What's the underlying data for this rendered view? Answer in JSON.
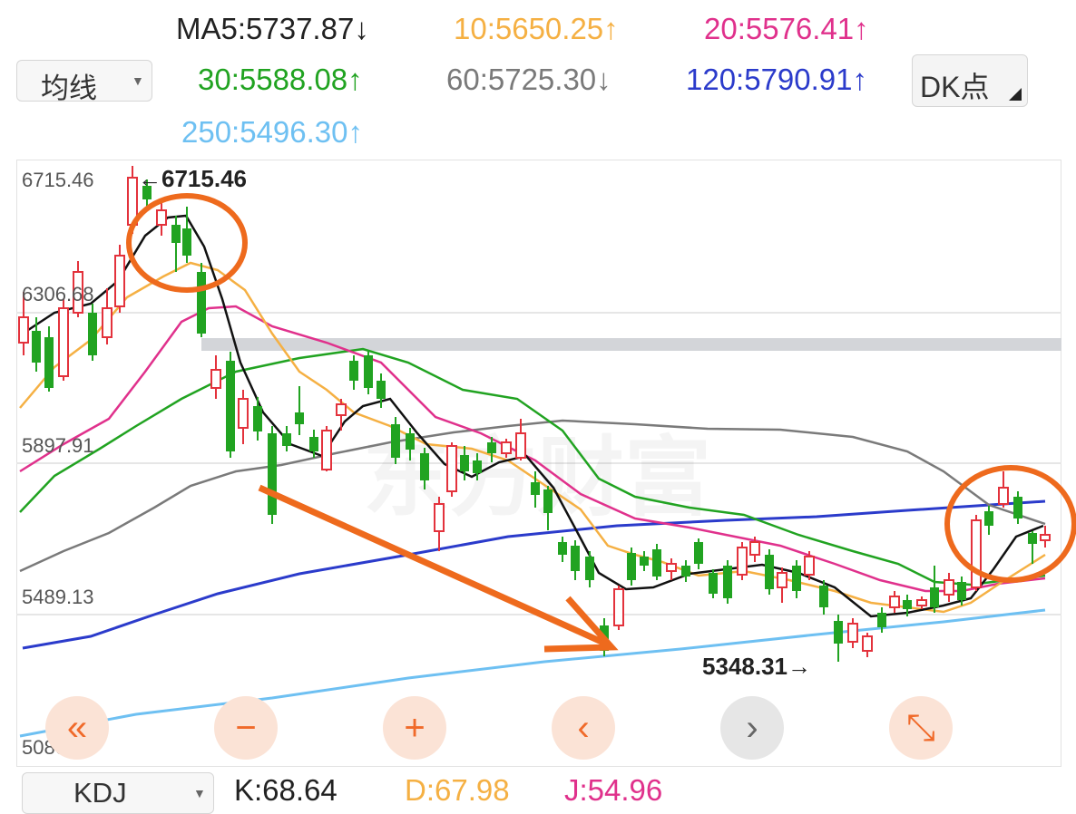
{
  "ma_selector": {
    "label": "均线",
    "arrow": "▼"
  },
  "ma": {
    "ma5": {
      "text": "MA5:5737.87",
      "arrow": "↓",
      "color": "#222222"
    },
    "ma10": {
      "text": "10:5650.25",
      "arrow": "↑",
      "color": "#f5b043"
    },
    "ma20": {
      "text": "20:5576.41",
      "arrow": "↑",
      "color": "#e0318c"
    },
    "ma30": {
      "text": "30:5588.08",
      "arrow": "↑",
      "color": "#21a321"
    },
    "ma60": {
      "text": "60:5725.30",
      "arrow": "↓",
      "color": "#7a7a7a"
    },
    "ma120": {
      "text": "120:5790.91",
      "arrow": "↑",
      "color": "#2b3bcb"
    },
    "ma250": {
      "text": "250:5496.30",
      "arrow": "↑",
      "color": "#6ec0f2"
    }
  },
  "dk_button": {
    "label": "DK点"
  },
  "y_axis": {
    "labels": [
      "6715.46",
      "6306.68",
      "5897.91",
      "5489.13",
      "5080.35"
    ]
  },
  "annotations": {
    "high": "←6715.46",
    "low": "5348.31→"
  },
  "watermark": "东方财富",
  "controls": {
    "first": "«",
    "zoom_out": "−",
    "zoom_in": "+",
    "prev": "‹",
    "next": "›",
    "fullscreen": "⤡"
  },
  "indicator_selector": {
    "label": "KDJ",
    "arrow": "▼"
  },
  "kdj": {
    "k": "K:68.64",
    "d": "D:67.98",
    "j": "J:54.96"
  },
  "colors": {
    "up": "#e3323c",
    "down": "#21a321",
    "highlight": "#ee6a1d"
  }
}
